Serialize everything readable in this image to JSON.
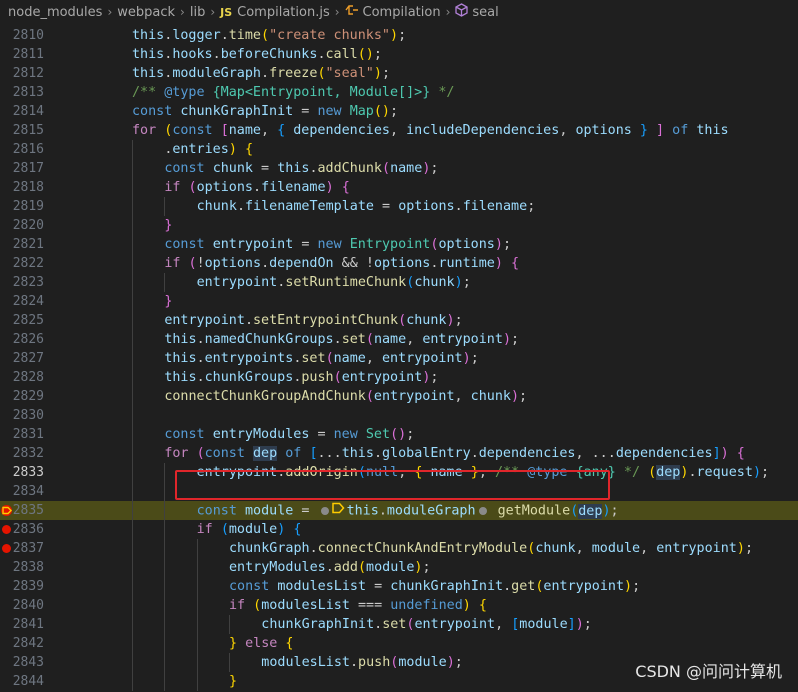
{
  "breadcrumb": {
    "items": [
      "node_modules",
      "webpack",
      "lib",
      "Compilation.js",
      "Compilation",
      "seal"
    ],
    "js_badge": "JS"
  },
  "watermark": "CSDN @问问计算机",
  "colors": {
    "current_line": "#4b4b18",
    "breakpoint": "#e51400",
    "highlight_box": "#e0262b"
  },
  "lines": [
    {
      "n": "2810",
      "indent": 2,
      "tokens": [
        [
          "v",
          "this"
        ],
        [
          "p",
          "."
        ],
        [
          "v",
          "logger"
        ],
        [
          "p",
          "."
        ],
        [
          "f",
          "time"
        ],
        [
          "b1",
          "("
        ],
        [
          "s",
          "\"create chunks\""
        ],
        [
          "b1",
          ")"
        ],
        [
          "p",
          ";"
        ]
      ]
    },
    {
      "n": "2811",
      "indent": 2,
      "tokens": [
        [
          "v",
          "this"
        ],
        [
          "p",
          "."
        ],
        [
          "v",
          "hooks"
        ],
        [
          "p",
          "."
        ],
        [
          "v",
          "beforeChunks"
        ],
        [
          "p",
          "."
        ],
        [
          "f",
          "call"
        ],
        [
          "b1",
          "()"
        ],
        [
          "p",
          ";"
        ]
      ]
    },
    {
      "n": "2812",
      "indent": 2,
      "tokens": [
        [
          "v",
          "this"
        ],
        [
          "p",
          "."
        ],
        [
          "v",
          "moduleGraph"
        ],
        [
          "p",
          "."
        ],
        [
          "f",
          "freeze"
        ],
        [
          "b1",
          "("
        ],
        [
          "s",
          "\"seal\""
        ],
        [
          "b1",
          ")"
        ],
        [
          "p",
          ";"
        ]
      ]
    },
    {
      "n": "2813",
      "indent": 2,
      "tokens": [
        [
          "c",
          "/** "
        ],
        [
          "k",
          "@type"
        ],
        [
          "c",
          " "
        ],
        [
          "t",
          "{Map<Entrypoint, Module[]>}"
        ],
        [
          "c",
          " */"
        ]
      ]
    },
    {
      "n": "2814",
      "indent": 2,
      "tokens": [
        [
          "k",
          "const "
        ],
        [
          "v",
          "chunkGraphInit"
        ],
        [
          "p",
          " = "
        ],
        [
          "k",
          "new "
        ],
        [
          "t",
          "Map"
        ],
        [
          "b1",
          "()"
        ],
        [
          "p",
          ";"
        ]
      ]
    },
    {
      "n": "2815",
      "indent": 2,
      "tokens": [
        [
          "kc",
          "for "
        ],
        [
          "b1",
          "("
        ],
        [
          "k",
          "const "
        ],
        [
          "b2",
          "["
        ],
        [
          "v",
          "name"
        ],
        [
          "p",
          ", "
        ],
        [
          "b3",
          "{ "
        ],
        [
          "v",
          "dependencies"
        ],
        [
          "p",
          ", "
        ],
        [
          "v",
          "includeDependencies"
        ],
        [
          "p",
          ", "
        ],
        [
          "v",
          "options"
        ],
        [
          "b3",
          " }"
        ],
        [
          "b2",
          " ]"
        ],
        [
          "k",
          " of "
        ],
        [
          "v",
          "this"
        ]
      ]
    },
    {
      "n": "2816",
      "indent": 3,
      "tokens": [
        [
          "p",
          "."
        ],
        [
          "v",
          "entries"
        ],
        [
          "b1",
          ")"
        ],
        [
          "p",
          " "
        ],
        [
          "b1",
          "{"
        ]
      ]
    },
    {
      "n": "2817",
      "indent": 3,
      "tokens": [
        [
          "k",
          "const "
        ],
        [
          "v",
          "chunk"
        ],
        [
          "p",
          " = "
        ],
        [
          "v",
          "this"
        ],
        [
          "p",
          "."
        ],
        [
          "f",
          "addChunk"
        ],
        [
          "b2",
          "("
        ],
        [
          "v",
          "name"
        ],
        [
          "b2",
          ")"
        ],
        [
          "p",
          ";"
        ]
      ]
    },
    {
      "n": "2818",
      "indent": 3,
      "tokens": [
        [
          "kc",
          "if "
        ],
        [
          "b2",
          "("
        ],
        [
          "v",
          "options"
        ],
        [
          "p",
          "."
        ],
        [
          "v",
          "filename"
        ],
        [
          "b2",
          ")"
        ],
        [
          "p",
          " "
        ],
        [
          "b2",
          "{"
        ]
      ]
    },
    {
      "n": "2819",
      "indent": 4,
      "tokens": [
        [
          "v",
          "chunk"
        ],
        [
          "p",
          "."
        ],
        [
          "v",
          "filenameTemplate"
        ],
        [
          "p",
          " = "
        ],
        [
          "v",
          "options"
        ],
        [
          "p",
          "."
        ],
        [
          "v",
          "filename"
        ],
        [
          "p",
          ";"
        ]
      ]
    },
    {
      "n": "2820",
      "indent": 3,
      "tokens": [
        [
          "b2",
          "}"
        ]
      ]
    },
    {
      "n": "2821",
      "indent": 3,
      "tokens": [
        [
          "k",
          "const "
        ],
        [
          "v",
          "entrypoint"
        ],
        [
          "p",
          " = "
        ],
        [
          "k",
          "new "
        ],
        [
          "t",
          "Entrypoint"
        ],
        [
          "b2",
          "("
        ],
        [
          "v",
          "options"
        ],
        [
          "b2",
          ")"
        ],
        [
          "p",
          ";"
        ]
      ]
    },
    {
      "n": "2822",
      "indent": 3,
      "tokens": [
        [
          "kc",
          "if "
        ],
        [
          "b2",
          "("
        ],
        [
          "p",
          "!"
        ],
        [
          "v",
          "options"
        ],
        [
          "p",
          "."
        ],
        [
          "v",
          "dependOn"
        ],
        [
          "p",
          " && !"
        ],
        [
          "v",
          "options"
        ],
        [
          "p",
          "."
        ],
        [
          "v",
          "runtime"
        ],
        [
          "b2",
          ")"
        ],
        [
          "p",
          " "
        ],
        [
          "b2",
          "{"
        ]
      ]
    },
    {
      "n": "2823",
      "indent": 4,
      "tokens": [
        [
          "v",
          "entrypoint"
        ],
        [
          "p",
          "."
        ],
        [
          "f",
          "setRuntimeChunk"
        ],
        [
          "b3",
          "("
        ],
        [
          "v",
          "chunk"
        ],
        [
          "b3",
          ")"
        ],
        [
          "p",
          ";"
        ]
      ]
    },
    {
      "n": "2824",
      "indent": 3,
      "tokens": [
        [
          "b2",
          "}"
        ]
      ]
    },
    {
      "n": "2825",
      "indent": 3,
      "tokens": [
        [
          "v",
          "entrypoint"
        ],
        [
          "p",
          "."
        ],
        [
          "f",
          "setEntrypointChunk"
        ],
        [
          "b2",
          "("
        ],
        [
          "v",
          "chunk"
        ],
        [
          "b2",
          ")"
        ],
        [
          "p",
          ";"
        ]
      ]
    },
    {
      "n": "2826",
      "indent": 3,
      "tokens": [
        [
          "v",
          "this"
        ],
        [
          "p",
          "."
        ],
        [
          "v",
          "namedChunkGroups"
        ],
        [
          "p",
          "."
        ],
        [
          "f",
          "set"
        ],
        [
          "b2",
          "("
        ],
        [
          "v",
          "name"
        ],
        [
          "p",
          ", "
        ],
        [
          "v",
          "entrypoint"
        ],
        [
          "b2",
          ")"
        ],
        [
          "p",
          ";"
        ]
      ]
    },
    {
      "n": "2827",
      "indent": 3,
      "tokens": [
        [
          "v",
          "this"
        ],
        [
          "p",
          "."
        ],
        [
          "v",
          "entrypoints"
        ],
        [
          "p",
          "."
        ],
        [
          "f",
          "set"
        ],
        [
          "b2",
          "("
        ],
        [
          "v",
          "name"
        ],
        [
          "p",
          ", "
        ],
        [
          "v",
          "entrypoint"
        ],
        [
          "b2",
          ")"
        ],
        [
          "p",
          ";"
        ]
      ]
    },
    {
      "n": "2828",
      "indent": 3,
      "tokens": [
        [
          "v",
          "this"
        ],
        [
          "p",
          "."
        ],
        [
          "v",
          "chunkGroups"
        ],
        [
          "p",
          "."
        ],
        [
          "f",
          "push"
        ],
        [
          "b2",
          "("
        ],
        [
          "v",
          "entrypoint"
        ],
        [
          "b2",
          ")"
        ],
        [
          "p",
          ";"
        ]
      ]
    },
    {
      "n": "2829",
      "indent": 3,
      "tokens": [
        [
          "f",
          "connectChunkGroupAndChunk"
        ],
        [
          "b2",
          "("
        ],
        [
          "v",
          "entrypoint"
        ],
        [
          "p",
          ", "
        ],
        [
          "v",
          "chunk"
        ],
        [
          "b2",
          ")"
        ],
        [
          "p",
          ";"
        ]
      ]
    },
    {
      "n": "2830",
      "indent": 3,
      "tokens": []
    },
    {
      "n": "2831",
      "indent": 3,
      "tokens": [
        [
          "k",
          "const "
        ],
        [
          "v",
          "entryModules"
        ],
        [
          "p",
          " = "
        ],
        [
          "k",
          "new "
        ],
        [
          "t",
          "Set"
        ],
        [
          "b2",
          "()"
        ],
        [
          "p",
          ";"
        ]
      ]
    },
    {
      "n": "2832",
      "indent": 3,
      "tokens": [
        [
          "kc",
          "for "
        ],
        [
          "b2",
          "("
        ],
        [
          "k",
          "const "
        ],
        [
          "vh",
          "dep"
        ],
        [
          "k",
          " of "
        ],
        [
          "b3",
          "["
        ],
        [
          "p",
          "..."
        ],
        [
          "v",
          "this"
        ],
        [
          "p",
          "."
        ],
        [
          "v",
          "globalEntry"
        ],
        [
          "p",
          "."
        ],
        [
          "v",
          "dependencies"
        ],
        [
          "p",
          ", ..."
        ],
        [
          "v",
          "dependencies"
        ],
        [
          "b3",
          "]"
        ],
        [
          "b2",
          ")"
        ],
        [
          "p",
          " "
        ],
        [
          "b2",
          "{"
        ]
      ]
    },
    {
      "n": "2833",
      "indent": 4,
      "active": true,
      "tokens": [
        [
          "v",
          "entrypoint"
        ],
        [
          "p",
          "."
        ],
        [
          "f",
          "addOrigin"
        ],
        [
          "b3",
          "("
        ],
        [
          "k",
          "null"
        ],
        [
          "p",
          ", "
        ],
        [
          "b1",
          "{ "
        ],
        [
          "v",
          "name"
        ],
        [
          "b1",
          " }"
        ],
        [
          "p",
          ", "
        ],
        [
          "c",
          "/** "
        ],
        [
          "k",
          "@type"
        ],
        [
          "c",
          " "
        ],
        [
          "t",
          "{any}"
        ],
        [
          "c",
          " */ "
        ],
        [
          "b1",
          "("
        ],
        [
          "vh",
          "dep"
        ],
        [
          "b1",
          ")"
        ],
        [
          "p",
          "."
        ],
        [
          "v",
          "request"
        ],
        [
          "b3",
          ")"
        ],
        [
          "p",
          ";"
        ]
      ]
    },
    {
      "n": "2834",
      "indent": 4,
      "tokens": []
    },
    {
      "n": "2835",
      "indent": 4,
      "current": true,
      "tokens": [
        [
          "k",
          "const "
        ],
        [
          "v",
          "module"
        ],
        [
          "p",
          " = "
        ],
        [
          "dot",
          ""
        ],
        [
          "cur",
          ""
        ],
        [
          "v",
          "this"
        ],
        [
          "p",
          "."
        ],
        [
          "v",
          "moduleGraph"
        ],
        [
          "dot",
          ""
        ],
        [
          "p",
          " "
        ],
        [
          "f",
          "getModule"
        ],
        [
          "b3",
          "("
        ],
        [
          "vh",
          "dep"
        ],
        [
          "b3",
          ")"
        ],
        [
          "p",
          ";"
        ]
      ]
    },
    {
      "n": "2836",
      "indent": 4,
      "bp": true,
      "tokens": [
        [
          "kc",
          "if "
        ],
        [
          "b3",
          "("
        ],
        [
          "v",
          "module"
        ],
        [
          "b3",
          ")"
        ],
        [
          "p",
          " "
        ],
        [
          "b3",
          "{"
        ]
      ]
    },
    {
      "n": "2837",
      "indent": 5,
      "bp": true,
      "tokens": [
        [
          "v",
          "chunkGraph"
        ],
        [
          "p",
          "."
        ],
        [
          "f",
          "connectChunkAndEntryModule"
        ],
        [
          "b1",
          "("
        ],
        [
          "v",
          "chunk"
        ],
        [
          "p",
          ", "
        ],
        [
          "v",
          "module"
        ],
        [
          "p",
          ", "
        ],
        [
          "v",
          "entrypoint"
        ],
        [
          "b1",
          ")"
        ],
        [
          "p",
          ";"
        ]
      ]
    },
    {
      "n": "2838",
      "indent": 5,
      "tokens": [
        [
          "v",
          "entryModules"
        ],
        [
          "p",
          "."
        ],
        [
          "f",
          "add"
        ],
        [
          "b1",
          "("
        ],
        [
          "v",
          "module"
        ],
        [
          "b1",
          ")"
        ],
        [
          "p",
          ";"
        ]
      ]
    },
    {
      "n": "2839",
      "indent": 5,
      "tokens": [
        [
          "k",
          "const "
        ],
        [
          "v",
          "modulesList"
        ],
        [
          "p",
          " = "
        ],
        [
          "v",
          "chunkGraphInit"
        ],
        [
          "p",
          "."
        ],
        [
          "f",
          "get"
        ],
        [
          "b1",
          "("
        ],
        [
          "v",
          "entrypoint"
        ],
        [
          "b1",
          ")"
        ],
        [
          "p",
          ";"
        ]
      ]
    },
    {
      "n": "2840",
      "indent": 5,
      "tokens": [
        [
          "kc",
          "if "
        ],
        [
          "b1",
          "("
        ],
        [
          "v",
          "modulesList"
        ],
        [
          "p",
          " === "
        ],
        [
          "k",
          "undefined"
        ],
        [
          "b1",
          ")"
        ],
        [
          "p",
          " "
        ],
        [
          "b1",
          "{"
        ]
      ]
    },
    {
      "n": "2841",
      "indent": 6,
      "tokens": [
        [
          "v",
          "chunkGraphInit"
        ],
        [
          "p",
          "."
        ],
        [
          "f",
          "set"
        ],
        [
          "b2",
          "("
        ],
        [
          "v",
          "entrypoint"
        ],
        [
          "p",
          ", "
        ],
        [
          "b3",
          "["
        ],
        [
          "v",
          "module"
        ],
        [
          "b3",
          "]"
        ],
        [
          "b2",
          ")"
        ],
        [
          "p",
          ";"
        ]
      ]
    },
    {
      "n": "2842",
      "indent": 5,
      "tokens": [
        [
          "b1",
          "}"
        ],
        [
          "kc",
          " else "
        ],
        [
          "b1",
          "{"
        ]
      ]
    },
    {
      "n": "2843",
      "indent": 6,
      "tokens": [
        [
          "v",
          "modulesList"
        ],
        [
          "p",
          "."
        ],
        [
          "f",
          "push"
        ],
        [
          "b2",
          "("
        ],
        [
          "v",
          "module"
        ],
        [
          "b2",
          ")"
        ],
        [
          "p",
          ";"
        ]
      ]
    },
    {
      "n": "2844",
      "indent": 5,
      "tokens": [
        [
          "b1",
          "}"
        ]
      ]
    }
  ]
}
